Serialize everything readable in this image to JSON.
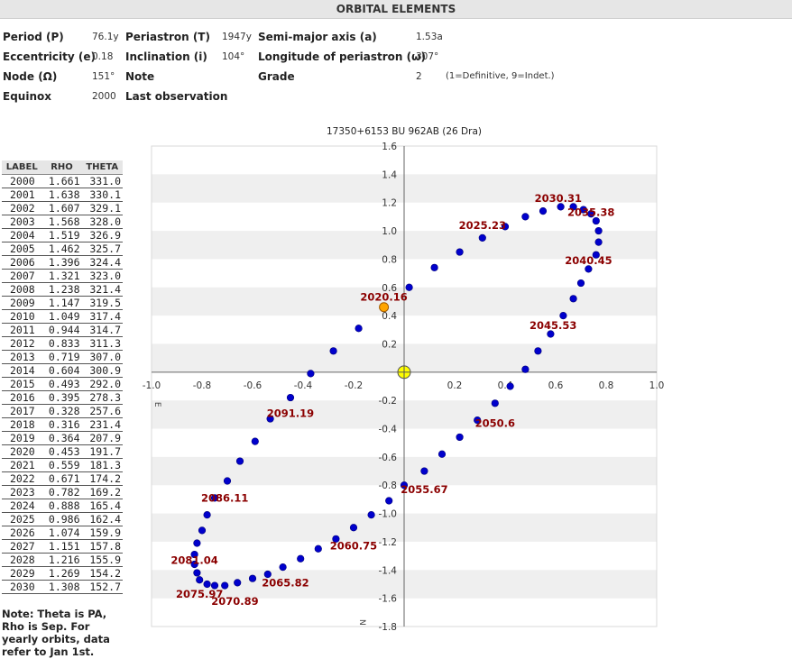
{
  "header": {
    "title": "ORBITAL ELEMENTS"
  },
  "elements": {
    "period_label": "Period (P)",
    "period_value": "76.1y",
    "periastron_label": "Periastron (T)",
    "periastron_value": "1947y",
    "semimajor_label": "Semi-major axis (a)",
    "semimajor_value": "1.53a",
    "eccentricity_label": "Eccentricity (e)",
    "eccentricity_value": "0.18",
    "inclination_label": "Inclination (i)",
    "inclination_value": "104°",
    "longitude_label": "Longitude of periastron (ω)",
    "longitude_value": "307°",
    "node_label": "Node (Ω)",
    "node_value": "151°",
    "note_label": "Note",
    "grade_label": "Grade",
    "grade_value": "2",
    "grade_note": "(1=Definitive, 9=Indet.)",
    "equinox_label": "Equinox",
    "equinox_value": "2000",
    "last_obs_label": "Last observation"
  },
  "ephemeris": {
    "columns": [
      "LABEL",
      "RHO",
      "THETA"
    ],
    "rows": [
      [
        "2000",
        "1.661",
        "331.0"
      ],
      [
        "2001",
        "1.638",
        "330.1"
      ],
      [
        "2002",
        "1.607",
        "329.1"
      ],
      [
        "2003",
        "1.568",
        "328.0"
      ],
      [
        "2004",
        "1.519",
        "326.9"
      ],
      [
        "2005",
        "1.462",
        "325.7"
      ],
      [
        "2006",
        "1.396",
        "324.4"
      ],
      [
        "2007",
        "1.321",
        "323.0"
      ],
      [
        "2008",
        "1.238",
        "321.4"
      ],
      [
        "2009",
        "1.147",
        "319.5"
      ],
      [
        "2010",
        "1.049",
        "317.4"
      ],
      [
        "2011",
        "0.944",
        "314.7"
      ],
      [
        "2012",
        "0.833",
        "311.3"
      ],
      [
        "2013",
        "0.719",
        "307.0"
      ],
      [
        "2014",
        "0.604",
        "300.9"
      ],
      [
        "2015",
        "0.493",
        "292.0"
      ],
      [
        "2016",
        "0.395",
        "278.3"
      ],
      [
        "2017",
        "0.328",
        "257.6"
      ],
      [
        "2018",
        "0.316",
        "231.4"
      ],
      [
        "2019",
        "0.364",
        "207.9"
      ],
      [
        "2020",
        "0.453",
        "191.7"
      ],
      [
        "2021",
        "0.559",
        "181.3"
      ],
      [
        "2022",
        "0.671",
        "174.2"
      ],
      [
        "2023",
        "0.782",
        "169.2"
      ],
      [
        "2024",
        "0.888",
        "165.4"
      ],
      [
        "2025",
        "0.986",
        "162.4"
      ],
      [
        "2026",
        "1.074",
        "159.9"
      ],
      [
        "2027",
        "1.151",
        "157.8"
      ],
      [
        "2028",
        "1.216",
        "155.9"
      ],
      [
        "2029",
        "1.269",
        "154.2"
      ],
      [
        "2030",
        "1.308",
        "152.7"
      ]
    ]
  },
  "note_text": "Note: Theta is PA, Rho is Sep. For yearly orbits, data refer to Jan 1st.",
  "chart_data": {
    "type": "scatter",
    "title": "17350+6153 BU  962AB (26 Dra)",
    "xlim": [
      -1.0,
      1.0
    ],
    "ylim": [
      -1.8,
      1.6
    ],
    "x_ticks": [
      "-1.0",
      "-0.8",
      "-0.6",
      "-0.4",
      "-0.2",
      "0.2",
      "0.4",
      "0.6",
      "0.8",
      "1.0"
    ],
    "y_ticks": [
      "1.6",
      "1.4",
      "1.2",
      "1.0",
      "0.8",
      "0.6",
      "0.4",
      "0.2",
      "-0.2",
      "-0.4",
      "-0.6",
      "-0.8",
      "-1.0",
      "-1.2",
      "-1.4",
      "-1.6",
      "-1.8"
    ],
    "axis_labels": {
      "east": "E",
      "north": "N"
    },
    "grid": "horizontal bands",
    "colors": {
      "orbit": "#0000cc",
      "current": "#ffa500",
      "primary": "#ffff00",
      "label": "#8b0000"
    },
    "primary": [
      0,
      0
    ],
    "current_position": {
      "label": "2020.16",
      "x": -0.08,
      "y": 0.46
    },
    "orbit_points": [
      [
        0.02,
        0.6
      ],
      [
        0.12,
        0.74
      ],
      [
        0.22,
        0.85
      ],
      [
        0.31,
        0.95
      ],
      [
        0.4,
        1.03
      ],
      [
        0.48,
        1.1
      ],
      [
        0.55,
        1.14
      ],
      [
        0.62,
        1.17
      ],
      [
        0.67,
        1.17
      ],
      [
        0.71,
        1.15
      ],
      [
        0.74,
        1.12
      ],
      [
        0.76,
        1.07
      ],
      [
        0.77,
        1.0
      ],
      [
        0.77,
        0.92
      ],
      [
        0.76,
        0.83
      ],
      [
        0.73,
        0.73
      ],
      [
        0.7,
        0.63
      ],
      [
        0.67,
        0.52
      ],
      [
        0.63,
        0.4
      ],
      [
        0.58,
        0.27
      ],
      [
        0.53,
        0.15
      ],
      [
        0.48,
        0.02
      ],
      [
        0.42,
        -0.1
      ],
      [
        0.36,
        -0.22
      ],
      [
        0.29,
        -0.34
      ],
      [
        0.22,
        -0.46
      ],
      [
        0.15,
        -0.58
      ],
      [
        0.08,
        -0.7
      ],
      [
        0.0,
        -0.8
      ],
      [
        -0.06,
        -0.91
      ],
      [
        -0.13,
        -1.01
      ],
      [
        -0.2,
        -1.1
      ],
      [
        -0.27,
        -1.18
      ],
      [
        -0.34,
        -1.25
      ],
      [
        -0.41,
        -1.32
      ],
      [
        -0.48,
        -1.38
      ],
      [
        -0.54,
        -1.43
      ],
      [
        -0.6,
        -1.46
      ],
      [
        -0.66,
        -1.49
      ],
      [
        -0.71,
        -1.51
      ],
      [
        -0.75,
        -1.51
      ],
      [
        -0.78,
        -1.5
      ],
      [
        -0.81,
        -1.47
      ],
      [
        -0.82,
        -1.42
      ],
      [
        -0.83,
        -1.36
      ],
      [
        -0.83,
        -1.29
      ],
      [
        -0.82,
        -1.21
      ],
      [
        -0.8,
        -1.12
      ],
      [
        -0.78,
        -1.01
      ],
      [
        -0.75,
        -0.89
      ],
      [
        -0.7,
        -0.77
      ],
      [
        -0.65,
        -0.63
      ],
      [
        -0.59,
        -0.49
      ],
      [
        -0.53,
        -0.33
      ],
      [
        -0.45,
        -0.18
      ],
      [
        -0.37,
        -0.01
      ],
      [
        -0.28,
        0.15
      ],
      [
        -0.18,
        0.31
      ]
    ],
    "annotations": [
      {
        "text": "2030.31",
        "x": 0.61,
        "y": 1.23
      },
      {
        "text": "2035.38",
        "x": 0.74,
        "y": 1.13
      },
      {
        "text": "2025.23",
        "x": 0.31,
        "y": 1.04
      },
      {
        "text": "2040.45",
        "x": 0.73,
        "y": 0.79
      },
      {
        "text": "2020.16",
        "x": -0.08,
        "y": 0.53
      },
      {
        "text": "2045.53",
        "x": 0.59,
        "y": 0.33
      },
      {
        "text": "2050.6",
        "x": 0.36,
        "y": -0.36
      },
      {
        "text": "2091.19",
        "x": -0.45,
        "y": -0.29
      },
      {
        "text": "2055.67",
        "x": 0.08,
        "y": -0.83
      },
      {
        "text": "2086.11",
        "x": -0.71,
        "y": -0.89
      },
      {
        "text": "2060.75",
        "x": -0.2,
        "y": -1.23
      },
      {
        "text": "2081.04",
        "x": -0.83,
        "y": -1.33
      },
      {
        "text": "2065.82",
        "x": -0.47,
        "y": -1.49
      },
      {
        "text": "2075.97",
        "x": -0.81,
        "y": -1.57
      },
      {
        "text": "2070.89",
        "x": -0.67,
        "y": -1.62
      }
    ]
  }
}
